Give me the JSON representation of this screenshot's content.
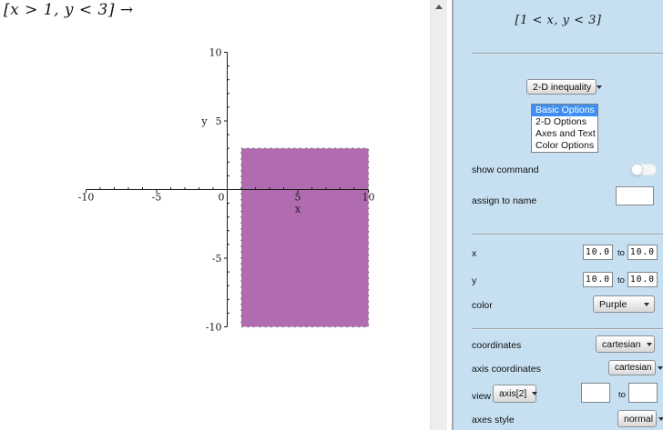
{
  "worksheet": {
    "expression": "[x > 1, y < 3] →"
  },
  "panel": {
    "expression": "[1 < x, y < 3]",
    "plot_type": "2-D inequality",
    "options_list": {
      "selected": "Basic Options",
      "items": [
        "Basic Options",
        "2-D Options",
        "Axes and Text",
        "Color Options"
      ]
    },
    "show_command": {
      "label": "show command",
      "enabled": false
    },
    "assign_to_name": {
      "label": "assign to name",
      "value": ""
    },
    "x_range": {
      "label": "x",
      "from": "10.0",
      "to_word": "to",
      "to": "10.0"
    },
    "y_range": {
      "label": "y",
      "from": "10.0",
      "to_word": "to",
      "to": "10.0"
    },
    "color": {
      "label": "color",
      "value": "Purple"
    },
    "coordinates": {
      "label": "coordinates",
      "value": "cartesian"
    },
    "axis_coordinates": {
      "label": "axis coordinates",
      "value": "cartesian"
    },
    "view": {
      "label": "view",
      "value": "axis[2]",
      "from": "",
      "to_word": "to",
      "to": ""
    },
    "axes_style": {
      "label": "axes style",
      "value": "normal"
    }
  },
  "chart_data": {
    "type": "area",
    "title": "",
    "xlabel": "x",
    "ylabel": "y",
    "xlim": [
      -10,
      10
    ],
    "ylim": [
      -10,
      10
    ],
    "x_tick_labels": [
      -10,
      -5,
      0,
      5,
      10
    ],
    "y_tick_labels": [
      -10,
      -5,
      5,
      10
    ],
    "minor_tick_step": 1,
    "grid": false,
    "legend": "none",
    "region": {
      "description": "x > 1 and y < 3",
      "x_range": [
        1,
        10
      ],
      "y_range": [
        -10,
        3
      ],
      "fill_color": "#b16cb1",
      "edge_color": "#5f5f5f",
      "edge_style": "dotted"
    }
  },
  "colors": {
    "panel_bg": "#c6e0f1",
    "selected_item_bg": "#3e8ff2",
    "selected_item_text": "#ffffff",
    "region_fill": "#b16cb1",
    "axis": "#1b1b1b"
  }
}
